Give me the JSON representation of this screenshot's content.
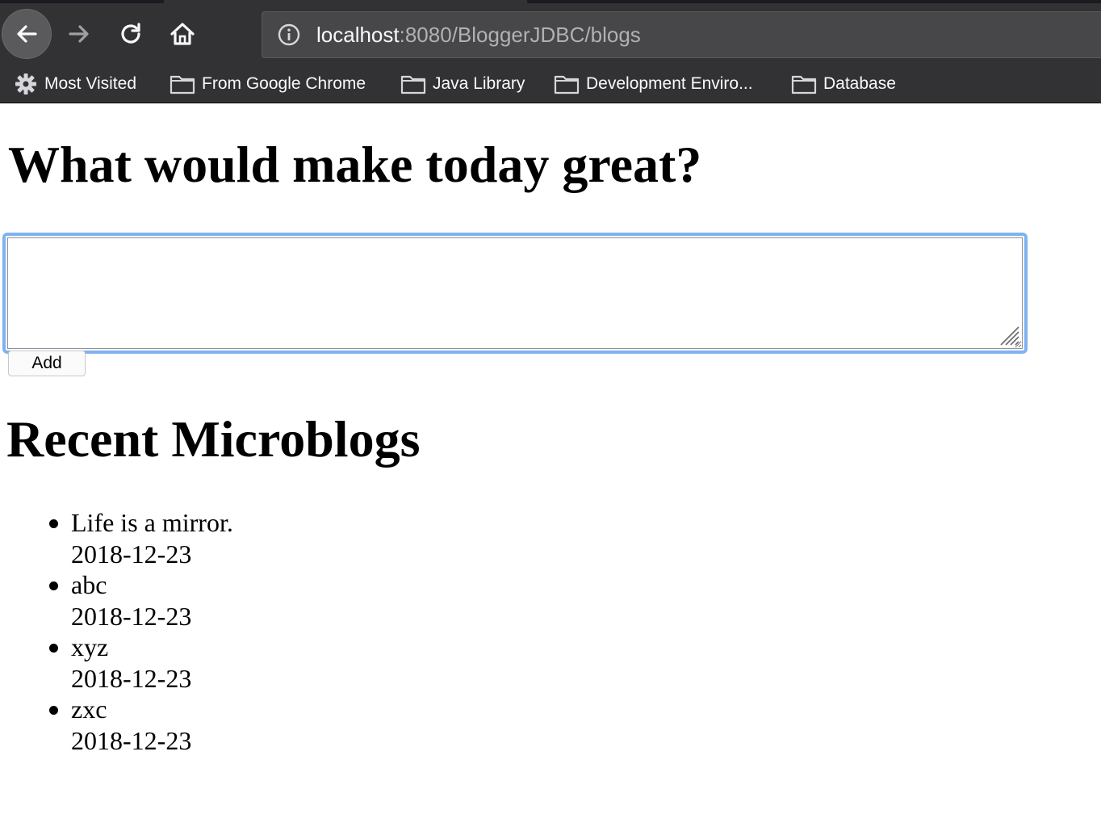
{
  "browser": {
    "url_host": "localhost",
    "url_rest": ":8080/BloggerJDBC/blogs",
    "bookmarks": [
      {
        "label": "Most Visited",
        "icon": "gear-icon"
      },
      {
        "label": "From Google Chrome",
        "icon": "folder-icon"
      },
      {
        "label": "Java Library",
        "icon": "folder-icon"
      },
      {
        "label": "Development Enviro...",
        "icon": "folder-icon"
      },
      {
        "label": "Database",
        "icon": "folder-icon"
      }
    ],
    "colors": {
      "toolbar": "#323234",
      "urlbar": "#474749",
      "focus_ring": "#7fb2f0"
    }
  },
  "page": {
    "question_heading": "What would make today great?",
    "blog_input_value": "",
    "add_button_label": "Add",
    "recent_heading": "Recent Microblogs",
    "blogs": [
      {
        "text": "Life is a mirror.",
        "date": "2018-12-23"
      },
      {
        "text": "abc",
        "date": "2018-12-23"
      },
      {
        "text": "xyz",
        "date": "2018-12-23"
      },
      {
        "text": "zxc",
        "date": "2018-12-23"
      }
    ]
  }
}
